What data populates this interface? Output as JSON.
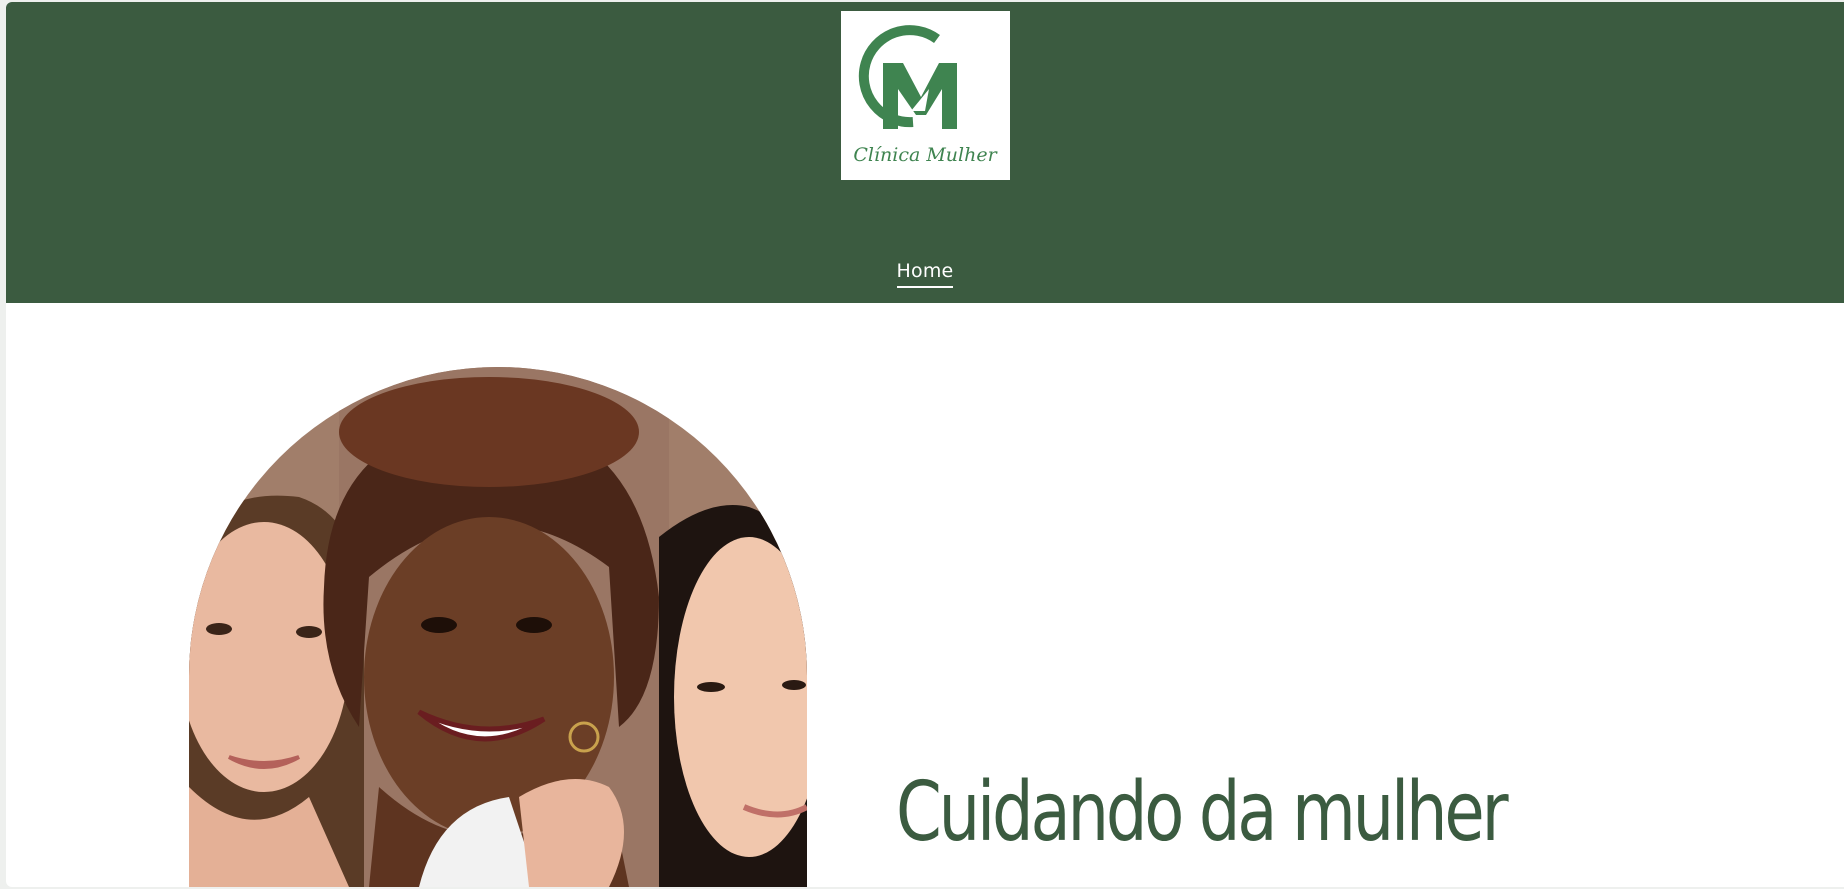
{
  "brand": {
    "logo_text": "Clínica Mulher",
    "logo_monogram": "CM",
    "primary_color": "#3b5b40",
    "logo_green": "#3f8450"
  },
  "nav": {
    "items": [
      {
        "label": "Home",
        "active": true
      }
    ]
  },
  "hero": {
    "title": "Cuidando da mulher",
    "image": "three-smiling-women-photo"
  }
}
